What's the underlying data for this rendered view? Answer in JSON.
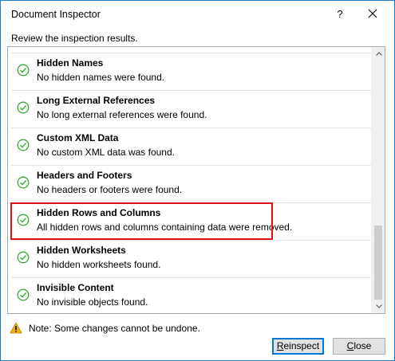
{
  "window": {
    "title": "Document Inspector",
    "help_label": "?",
    "prompt": "Review the inspection results."
  },
  "results": [
    {
      "name": "Hidden Names",
      "description": "No hidden names were found.",
      "status": "passed"
    },
    {
      "name": "Long External References",
      "description": "No long external references were found.",
      "status": "passed"
    },
    {
      "name": "Custom XML Data",
      "description": "No custom XML data was found.",
      "status": "passed"
    },
    {
      "name": "Headers and Footers",
      "description": "No headers or footers were found.",
      "status": "passed"
    },
    {
      "name": "Hidden Rows and Columns",
      "description": "All hidden rows and columns containing data were removed.",
      "status": "removed",
      "highlighted": true
    },
    {
      "name": "Hidden Worksheets",
      "description": "No hidden worksheets found.",
      "status": "passed"
    },
    {
      "name": "Invisible Content",
      "description": "No invisible objects found.",
      "status": "passed"
    }
  ],
  "note": {
    "icon": "warning-icon",
    "text": "Note: Some changes cannot be undone."
  },
  "buttons": {
    "reinspect_label": "Reinspect",
    "close_label": "Close"
  },
  "colors": {
    "check_green": "#3aa935",
    "highlight_red": "#e0101b",
    "accent_blue": "#0078d7",
    "warning_yellow": "#f0b400"
  },
  "icons": {
    "status": "check-circle-icon",
    "close": "close-icon",
    "scroll_up": "chevron-up-icon",
    "scroll_down": "chevron-down-icon"
  }
}
